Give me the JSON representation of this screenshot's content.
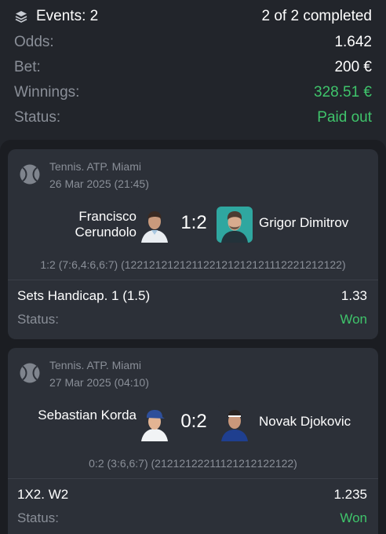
{
  "summary": {
    "events_label": "Events: 2",
    "completed": "2 of 2 completed",
    "odds_label": "Odds:",
    "odds_value": "1.642",
    "bet_label": "Bet:",
    "bet_value": "200 €",
    "winnings_label": "Winnings:",
    "winnings_value": "328.51 €",
    "status_label": "Status:",
    "status_value": "Paid out",
    "colors": {
      "green": "#3fc46b",
      "muted": "#8a8f98"
    }
  },
  "events": [
    {
      "tournament": "Tennis. ATP. Miami",
      "date": "26 Mar 2025 (21:45)",
      "player1": "Francisco Cerundolo",
      "player2": "Grigor Dimitrov",
      "score": "1:2",
      "detail": "1:2 (7:6,4:6,6:7) (122121212121122121212121112221212122)",
      "bet_name": "Sets Handicap. 1 (1.5)",
      "bet_odds": "1.33",
      "status_label": "Status:",
      "status_value": "Won",
      "icon": "tennis-ball-icon"
    },
    {
      "tournament": "Tennis. ATP. Miami",
      "date": "27 Mar 2025 (04:10)",
      "player1": "Sebastian Korda",
      "player2": "Novak Djokovic",
      "score": "0:2",
      "detail": "0:2 (3:6,6:7) (21212122211121212122122)",
      "bet_name": "1X2. W2",
      "bet_odds": "1.235",
      "status_label": "Status:",
      "status_value": "Won",
      "icon": "tennis-ball-icon"
    }
  ]
}
